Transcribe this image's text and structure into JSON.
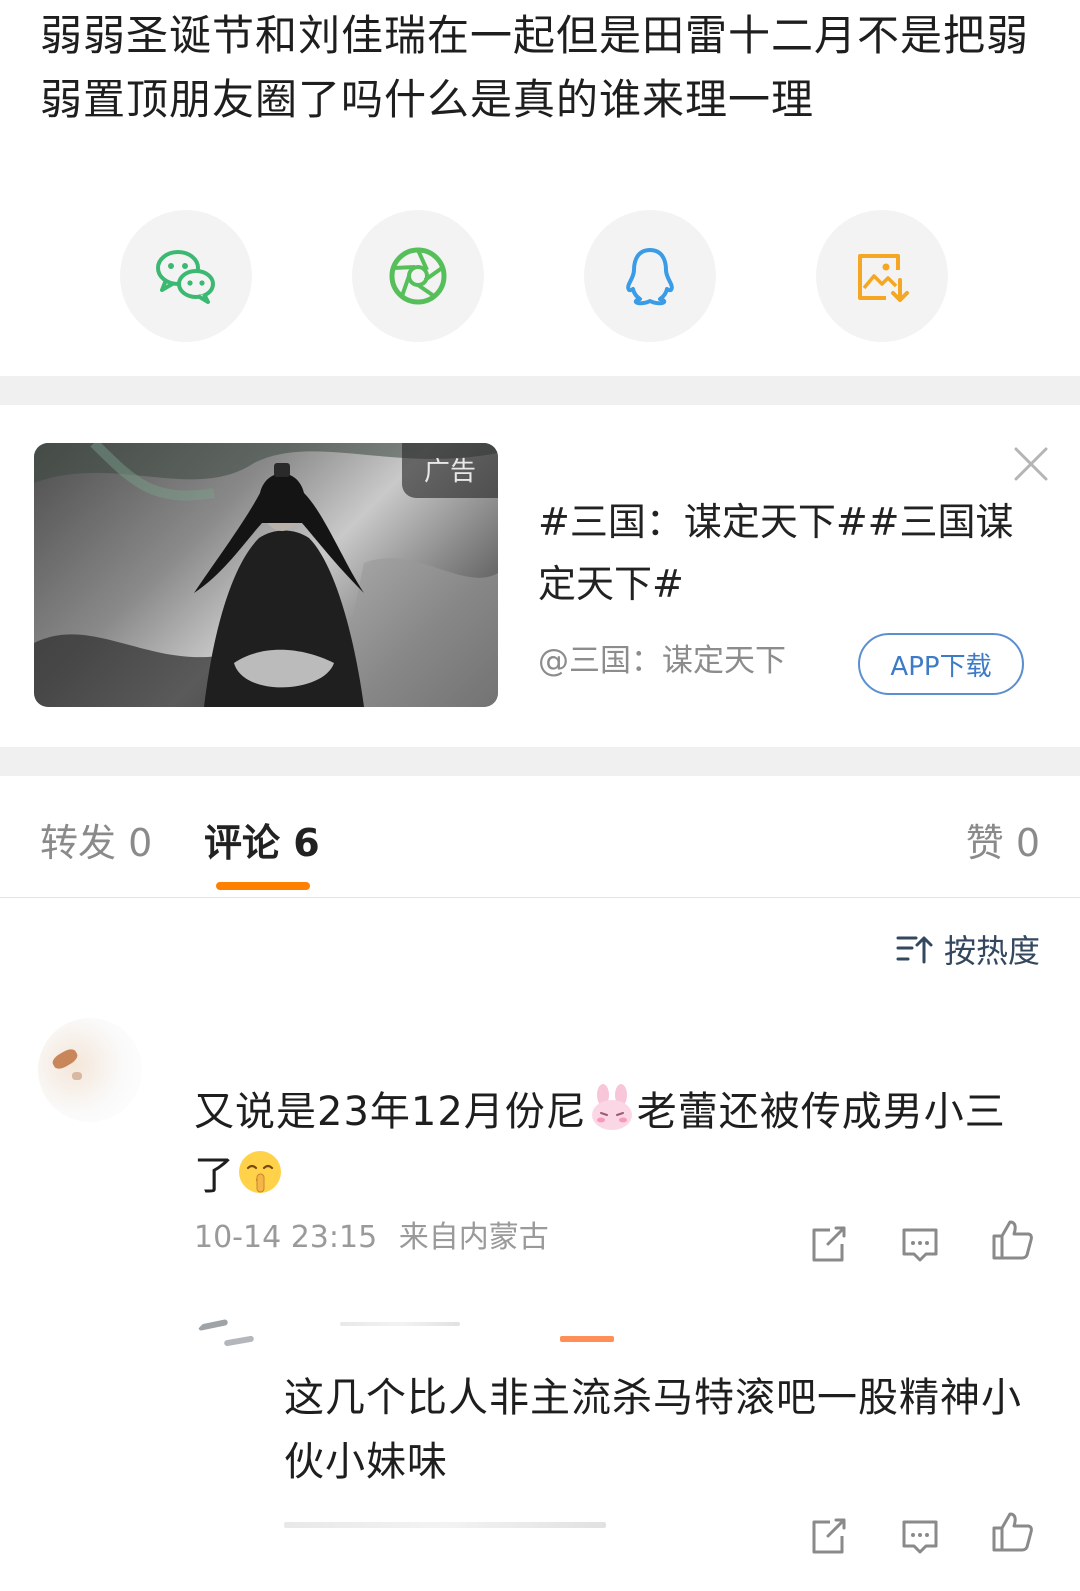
{
  "post": {
    "text": "弱弱圣诞节和刘佳瑞在一起但是田雷十二月不是把弱弱置顶朋友圈了吗什么是真的谁来理一理"
  },
  "share": {
    "icons": [
      "wechat-icon",
      "moments-icon",
      "qq-icon",
      "save-image-icon"
    ],
    "colors": {
      "wechat": "#3bb972",
      "moments": "#56bf5a",
      "qq": "#3a9be6",
      "save": "#f5a623"
    }
  },
  "ad": {
    "badge": "广告",
    "title": "#三国：谋定天下##三国谋定天下#",
    "source": "@三国：谋定天下",
    "button": "APP下载"
  },
  "tabs": {
    "repost": "转发 0",
    "comments": "评论 6",
    "likes": "赞 0",
    "accent": "#ff7f00"
  },
  "sort": {
    "label": "按热度"
  },
  "comments": [
    {
      "text_before": "又说是23年12月份尼",
      "text_middle": "老蕾还被传成男小三了",
      "time": "10-14 23:15",
      "location": "来自内蒙古"
    },
    {
      "text": "这几个比人非主流杀马特滚吧一股精神小伙小妹味"
    }
  ]
}
